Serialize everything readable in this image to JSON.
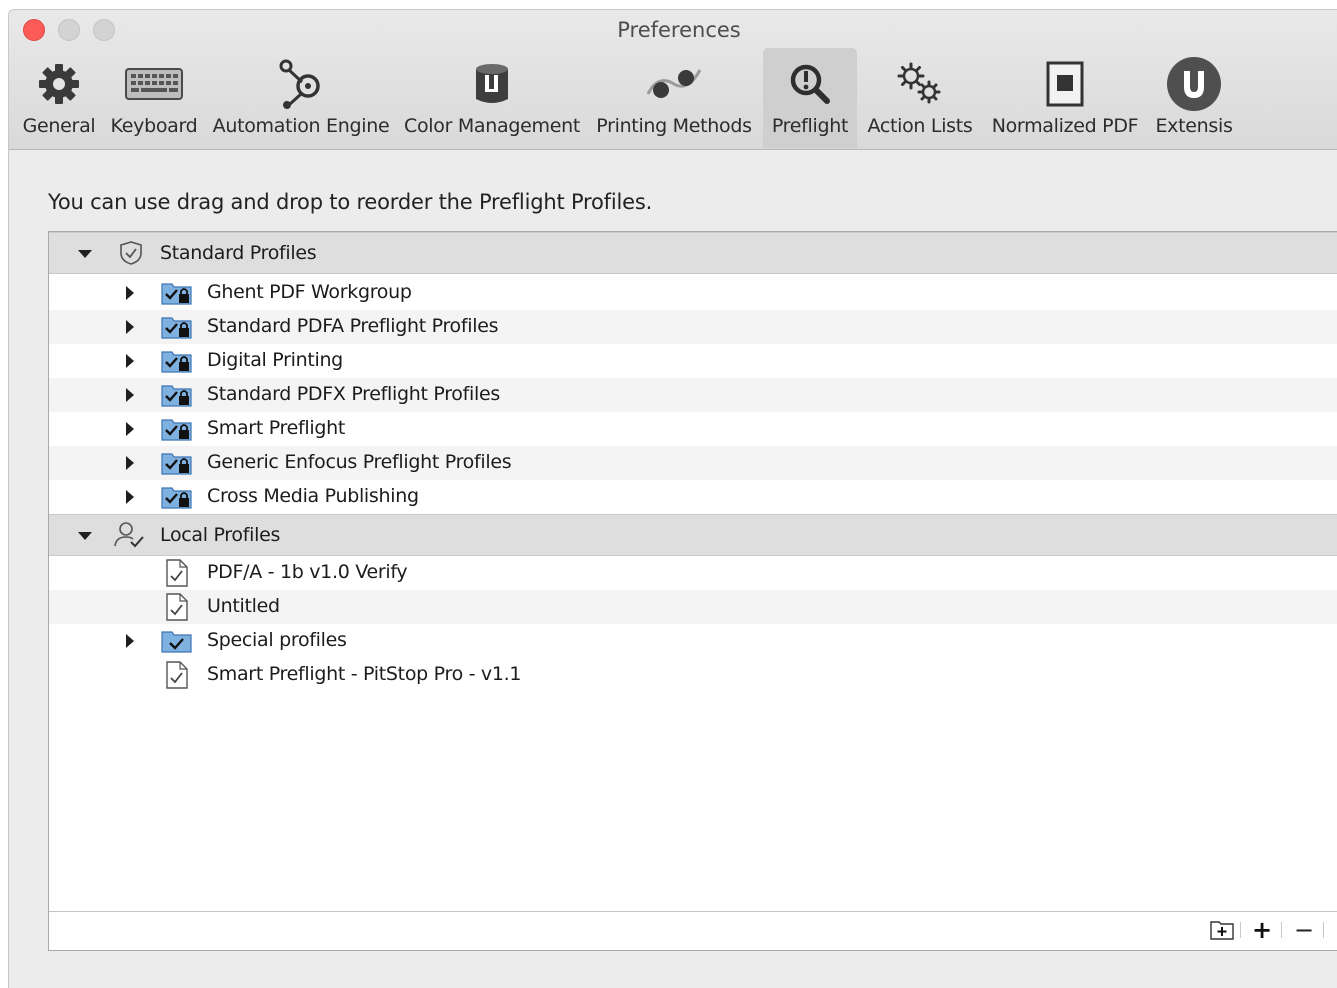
{
  "window": {
    "title": "Preferences"
  },
  "toolbar": {
    "items": [
      {
        "label": "General",
        "icon": "gear-icon"
      },
      {
        "label": "Keyboard",
        "icon": "keyboard-icon"
      },
      {
        "label": "Automation Engine",
        "icon": "automation-icon"
      },
      {
        "label": "Color Management",
        "icon": "color-management-icon"
      },
      {
        "label": "Printing Methods",
        "icon": "printing-methods-icon"
      },
      {
        "label": "Preflight",
        "icon": "preflight-icon",
        "selected": true
      },
      {
        "label": "Action Lists",
        "icon": "action-lists-icon"
      },
      {
        "label": "Normalized PDF",
        "icon": "normalized-pdf-icon"
      },
      {
        "label": "Extensis",
        "icon": "extensis-icon"
      }
    ]
  },
  "hint": "You can use drag and drop to reorder the Preflight Profiles.",
  "profiles": {
    "standard": {
      "label": "Standard Profiles",
      "items": [
        {
          "label": "Ghent PDF Workgroup"
        },
        {
          "label": "Standard PDFA Preflight Profiles"
        },
        {
          "label": "Digital Printing"
        },
        {
          "label": "Standard PDFX Preflight Profiles"
        },
        {
          "label": "Smart Preflight"
        },
        {
          "label": "Generic Enfocus Preflight Profiles"
        },
        {
          "label": "Cross Media Publishing"
        }
      ]
    },
    "local": {
      "label": "Local Profiles",
      "items": [
        {
          "label": "PDF/A - 1b v1.0 Verify",
          "kind": "document"
        },
        {
          "label": "Untitled",
          "kind": "document"
        },
        {
          "label": "Special profiles",
          "kind": "folder"
        },
        {
          "label": "Smart Preflight - PitStop Pro - v1.1",
          "kind": "document"
        }
      ]
    }
  },
  "bottom_bar": {
    "add_label": "+",
    "remove_label": "−"
  },
  "colors": {
    "close": "#fc5b57",
    "folder_blue": "#5b9bd5",
    "selected_tab": "#cfcfcf"
  }
}
